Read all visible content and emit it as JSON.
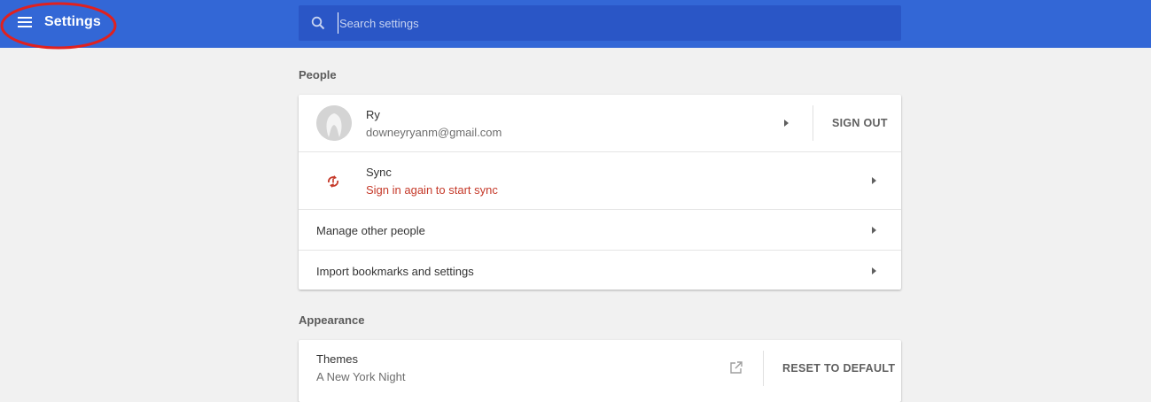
{
  "toolbar": {
    "title": "Settings",
    "menu_icon": "hamburger-menu-icon",
    "search_placeholder": "Search settings",
    "search_icon": "search-icon",
    "color": "#3367d6"
  },
  "annotation": {
    "color": "#e0211f"
  },
  "people": {
    "section_title": "People",
    "profile": {
      "name": "Ry",
      "email": "downeyryanm@gmail.com",
      "sign_out_label": "SIGN OUT",
      "avatar_icon": "avatar-icon"
    },
    "sync": {
      "label": "Sync",
      "status": "Sign in again to start sync",
      "icon": "sync-error-icon",
      "status_color": "#c53929"
    },
    "manage_label": "Manage other people",
    "import_label": "Import bookmarks and settings"
  },
  "appearance": {
    "section_title": "Appearance",
    "themes": {
      "label": "Themes",
      "value": "A New York Night",
      "open_icon": "open-in-new-icon",
      "reset_label": "RESET TO DEFAULT"
    }
  }
}
